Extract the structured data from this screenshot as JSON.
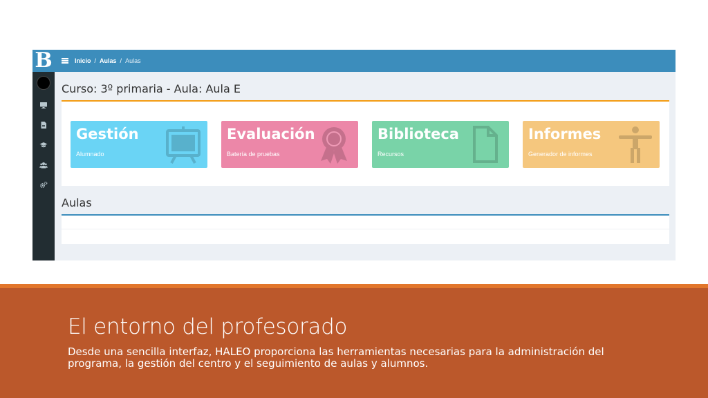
{
  "app": {
    "logo_letter": "B",
    "breadcrumb": [
      "Inicio",
      "Aulas",
      "Aulas"
    ],
    "breadcrumb_separator": "/",
    "sidebar_icons": [
      "desktop-icon",
      "file-icon",
      "graduation-cap-icon",
      "users-icon",
      "cogs-icon"
    ],
    "page_heading": "Curso: 3º primaria - Aula: Aula E",
    "tiles": [
      {
        "title": "Gestión",
        "subtitle": "Alumnado",
        "color": "#6ad4f5",
        "icon": "easel-icon"
      },
      {
        "title": "Evaluación",
        "subtitle": "Batería de pruebas",
        "color": "#ec87a8",
        "icon": "award-icon"
      },
      {
        "title": "Biblioteca",
        "subtitle": "Recursos",
        "color": "#79d3a8",
        "icon": "document-icon"
      },
      {
        "title": "Informes",
        "subtitle": "Generador de informes",
        "color": "#f5c77e",
        "icon": "accessibility-icon"
      }
    ],
    "section_heading": "Aulas"
  },
  "colors": {
    "topbar": "#3c8dbc",
    "sidebar": "#222d32",
    "content_bg": "#ecf0f5",
    "box_accent_orange": "#f39c12",
    "box_accent_blue": "#3c8dbc",
    "band": "#bb582b",
    "band_accent": "#e2762b"
  },
  "slide": {
    "title": "El entorno del profesorado",
    "body": "Desde una sencilla interfaz, HALEO proporciona las herramientas necesarias para la administración del programa, la gestión del centro y el seguimiento de aulas y alumnos."
  }
}
